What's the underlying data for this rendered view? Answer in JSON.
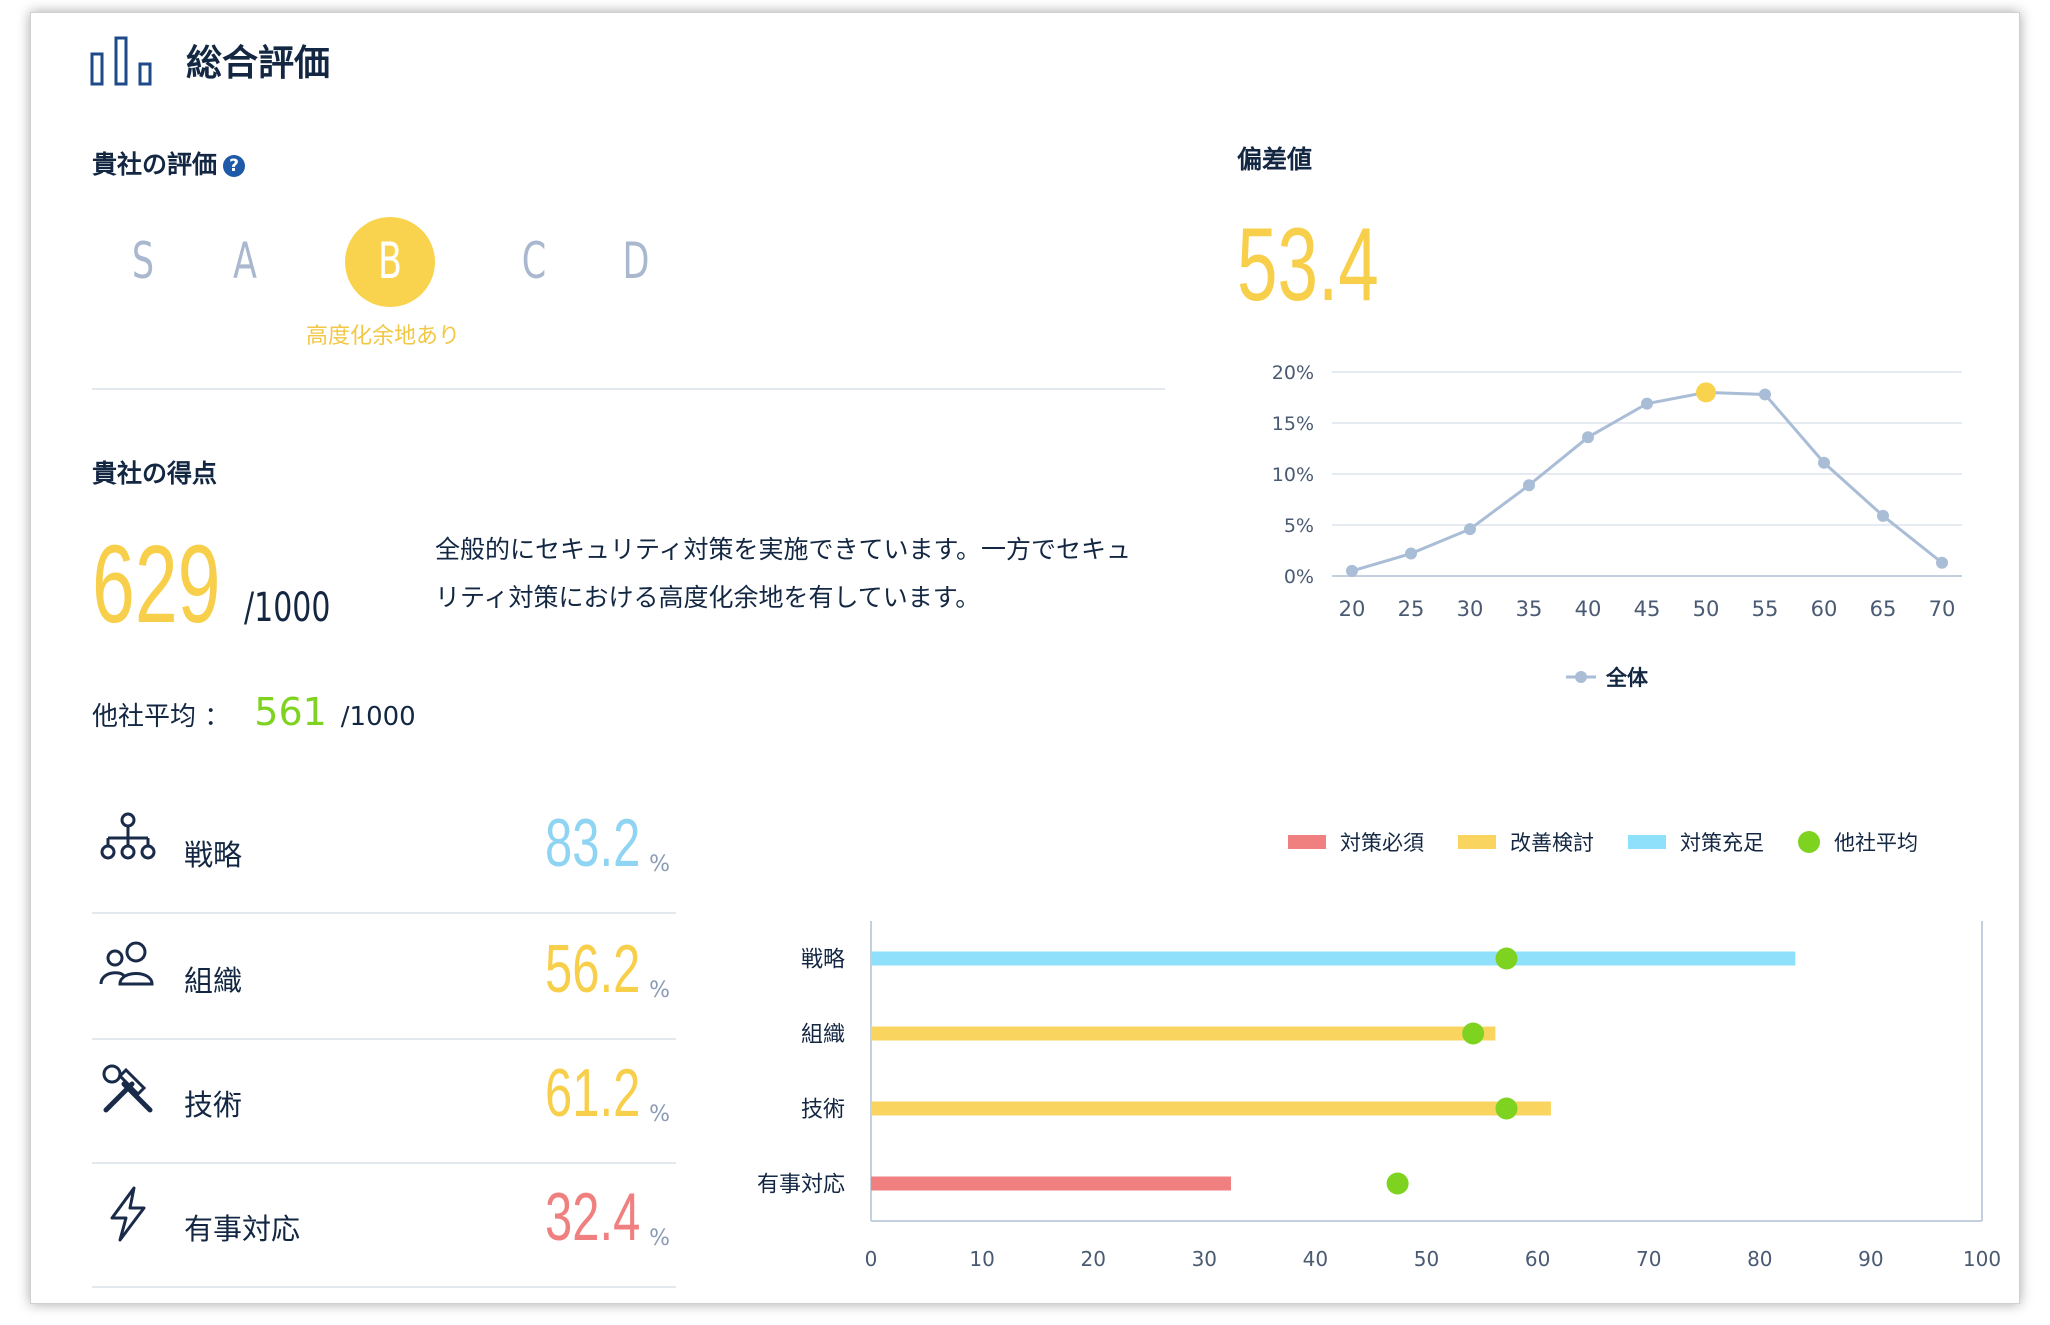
{
  "header": {
    "title": "総合評価",
    "icon": "bar-chart-icon"
  },
  "rating": {
    "title": "貴社の評価",
    "help_icon": "?",
    "grades": [
      "S",
      "A",
      "B",
      "C",
      "D"
    ],
    "selected": "B",
    "selected_desc": "高度化余地あり",
    "accent_color": "#f9d34d"
  },
  "deviation": {
    "title": "偏差値",
    "value": "53.4"
  },
  "score": {
    "title": "貴社の得点",
    "value": "629",
    "denominator": "/1000",
    "description": "全般的にセキュリティ対策を実施できています。一方でセキュリティ対策における高度化余地を有しています。",
    "avg_label": "他社平均 ：",
    "avg_value": "561",
    "avg_denominator": "/1000"
  },
  "categories": [
    {
      "name": "戦略",
      "value": "83.2",
      "unit": "%",
      "icon": "hierarchy-icon",
      "color": "#8fd4f2"
    },
    {
      "name": "組織",
      "value": "56.2",
      "unit": "%",
      "icon": "people-icon",
      "color": "#f8cf4a"
    },
    {
      "name": "技術",
      "value": "61.2",
      "unit": "%",
      "icon": "tools-icon",
      "color": "#f8cf4a"
    },
    {
      "name": "有事対応",
      "value": "32.4",
      "unit": "%",
      "icon": "lightning-icon",
      "color": "#f08080"
    }
  ],
  "chart_data": [
    {
      "type": "line",
      "x": [
        20,
        25,
        30,
        35,
        40,
        45,
        50,
        55,
        60,
        65,
        70
      ],
      "series": [
        {
          "name": "全体",
          "values": [
            0.5,
            2.2,
            4.6,
            8.9,
            13.6,
            16.9,
            18.0,
            17.8,
            11.1,
            5.9,
            1.3
          ]
        }
      ],
      "highlight": {
        "x": 50,
        "y": 18.0,
        "color": "#f9d34d"
      },
      "y_ticks": [
        "0%",
        "5%",
        "10%",
        "15%",
        "20%"
      ],
      "ylim": [
        0,
        20
      ],
      "grid": true,
      "legend": "bottom",
      "color": "#a9bdd6"
    },
    {
      "type": "bar",
      "orientation": "horizontal",
      "categories": [
        "戦略",
        "組織",
        "技術",
        "有事対応"
      ],
      "values": [
        83.2,
        56.2,
        61.2,
        32.4
      ],
      "bar_colors": [
        "#8fe0fb",
        "#f9d560",
        "#f9d560",
        "#f08080"
      ],
      "avg_values": [
        57.2,
        54.2,
        57.2,
        47.4
      ],
      "x_ticks": [
        "0",
        "10",
        "20",
        "30",
        "40",
        "50",
        "60",
        "70",
        "80",
        "90",
        "100"
      ],
      "xlim": [
        0,
        100
      ],
      "legend": "top-right",
      "legend_items": [
        {
          "label": "対策必須",
          "color": "#f08080",
          "kind": "bar"
        },
        {
          "label": "改善検討",
          "color": "#f9d560",
          "kind": "bar"
        },
        {
          "label": "対策充足",
          "color": "#8fe0fb",
          "kind": "bar"
        },
        {
          "label": "他社平均",
          "color": "#7ed321",
          "kind": "dot"
        }
      ]
    }
  ]
}
